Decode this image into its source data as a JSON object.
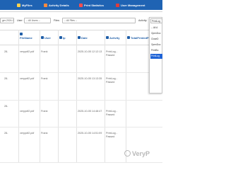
{
  "nav": {
    "items": [
      {
        "label": "MyFiles",
        "icon": "folder-icon",
        "color": "#ffd24d"
      },
      {
        "label": "Activity Details",
        "icon": "list-icon",
        "color": "#ff8a3d"
      },
      {
        "label": "Print Statistics",
        "icon": "chart-icon",
        "color": "#ff4d4d"
      },
      {
        "label": "User Management",
        "icon": "user-icon",
        "color": "#e03b3b"
      }
    ]
  },
  "filters": {
    "date_to": "ger-2024-03",
    "user_label": "User:",
    "user_value": "-- All Users --",
    "files_label": "Files:",
    "files_value": "-- All Files --",
    "activity_label": "Activity:",
    "activity_value": "PrintLog"
  },
  "columns": [
    "FileName",
    "User",
    "Ip",
    "Date",
    "Activity",
    "TotalPrintedPa"
  ],
  "rows": [
    {
      "cut": "28-",
      "file": "verypdf2.pdf",
      "user": "Frank",
      "date": "2025-10-05 12:12:13",
      "activity": "PrintLog - Passed"
    },
    {
      "cut": "28-",
      "file": "verypdf2.pdf",
      "user": "Frank",
      "date": "2025-10-05 13:13:35",
      "activity": "PrintLog - Passed"
    },
    {
      "cut": "28-",
      "file": "verypdf2.pdf",
      "user": "Frank",
      "date": "2025-10-05 14:48:47",
      "activity": "PrintLog - Passed"
    },
    {
      "cut": "28-",
      "file": "verypdf2.pdf",
      "user": "Frank",
      "date": "2025-10-05 14:51:09",
      "activity": "PrintLog - Passed"
    }
  ],
  "dropdown": {
    "header": "PrintLog",
    "options": [
      "-- All A",
      "OpenDoc",
      "CloseD",
      "OpenDoc",
      "PrintBu",
      "PrintLog"
    ],
    "selected_index": 5
  },
  "watermark": "VeryP"
}
